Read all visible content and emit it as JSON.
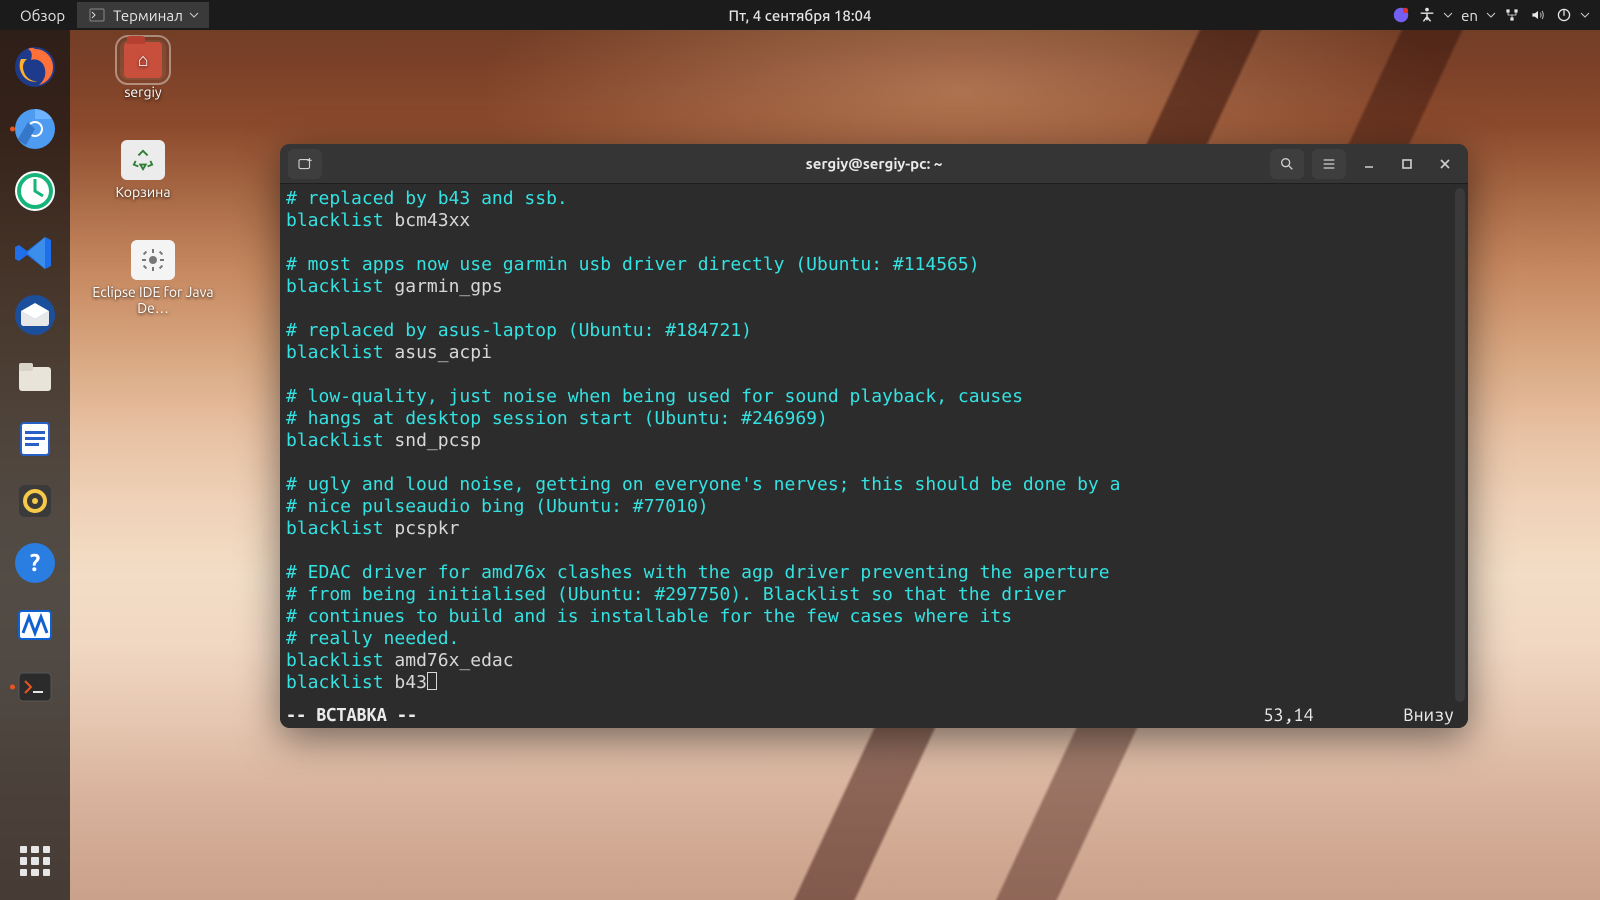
{
  "topbar": {
    "overview": "Обзор",
    "app_menu": "Терминал",
    "datetime": "Пт, 4 сентября  18:04",
    "lang": "en"
  },
  "desktop_icons": {
    "home": "sergiy",
    "trash": "Корзина",
    "eclipse": "Eclipse IDE for Java De…"
  },
  "terminal": {
    "title": "sergiy@sergiy-pc: ~",
    "lines": [
      {
        "t": "cmt",
        "s": "# replaced by b43 and ssb."
      },
      {
        "t": "bl",
        "k": "blacklist",
        "a": "bcm43xx"
      },
      {
        "t": "blank"
      },
      {
        "t": "cmt",
        "s": "# most apps now use garmin usb driver directly (Ubuntu: #114565)"
      },
      {
        "t": "bl",
        "k": "blacklist",
        "a": "garmin_gps"
      },
      {
        "t": "blank"
      },
      {
        "t": "cmt",
        "s": "# replaced by asus-laptop (Ubuntu: #184721)"
      },
      {
        "t": "bl",
        "k": "blacklist",
        "a": "asus_acpi"
      },
      {
        "t": "blank"
      },
      {
        "t": "cmt",
        "s": "# low-quality, just noise when being used for sound playback, causes"
      },
      {
        "t": "cmt",
        "s": "# hangs at desktop session start (Ubuntu: #246969)"
      },
      {
        "t": "bl",
        "k": "blacklist",
        "a": "snd_pcsp"
      },
      {
        "t": "blank"
      },
      {
        "t": "cmt",
        "s": "# ugly and loud noise, getting on everyone's nerves; this should be done by a"
      },
      {
        "t": "cmt",
        "s": "# nice pulseaudio bing (Ubuntu: #77010)"
      },
      {
        "t": "bl",
        "k": "blacklist",
        "a": "pcspkr"
      },
      {
        "t": "blank"
      },
      {
        "t": "cmt",
        "s": "# EDAC driver for amd76x clashes with the agp driver preventing the aperture"
      },
      {
        "t": "cmt",
        "s": "# from being initialised (Ubuntu: #297750). Blacklist so that the driver"
      },
      {
        "t": "cmt",
        "s": "# continues to build and is installable for the few cases where its"
      },
      {
        "t": "cmt",
        "s": "# really needed."
      },
      {
        "t": "bl",
        "k": "blacklist",
        "a": "amd76x_edac"
      },
      {
        "t": "bl",
        "k": "blacklist",
        "a": "b43",
        "cursor": true
      }
    ],
    "status": {
      "mode": "-- ВСТАВКА --",
      "pos": "53,14",
      "where": "Внизу"
    }
  }
}
